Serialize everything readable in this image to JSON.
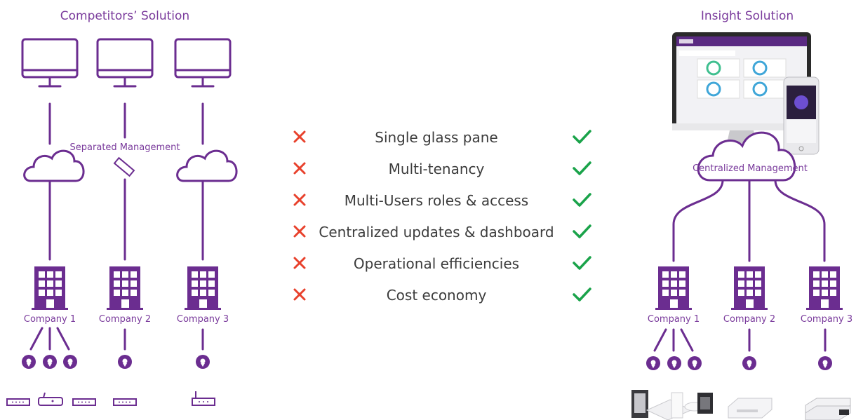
{
  "left": {
    "title": "Competitors’ Solution",
    "separated_label": "Separated Management",
    "companies": [
      "Company 1",
      "Company 2",
      "Company 3"
    ]
  },
  "right": {
    "title": "Insight Solution",
    "cloud_label": "Centralized Management",
    "companies": [
      "Company 1",
      "Company 2",
      "Company 3"
    ]
  },
  "features": [
    "Single glass pane",
    "Multi-tenancy",
    "Multi-Users roles & access",
    "Centralized updates & dashboard",
    "Operational efficiencies",
    "Cost economy"
  ],
  "colors": {
    "brand": "#6b2d90",
    "cross": "#e8412c",
    "check": "#1aa34a"
  },
  "icons": {
    "cross": "cross-icon",
    "check": "check-icon"
  }
}
